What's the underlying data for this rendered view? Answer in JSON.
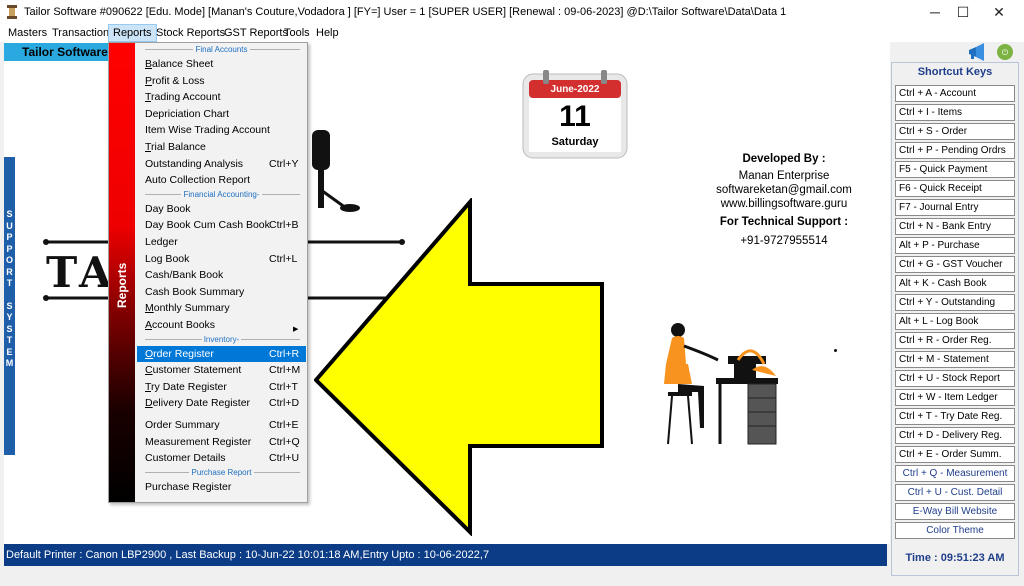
{
  "window": {
    "title": "Tailor Software #090622  [Edu. Mode] [Manan's Couture,Vodadora ] [FY=] User =  1 [SUPER USER]  [Renewal : 09-06-2023] @D:\\Tailor Software\\Data\\Data 1",
    "minimize": "─",
    "maximize": "☐",
    "close": "✕"
  },
  "menubar": [
    "Masters",
    "Transactions",
    "Reports",
    "Stock Reports",
    "GST Reports",
    "Tools",
    "Help"
  ],
  "app_label": "Tailor Software",
  "support_strip": [
    "S",
    "U",
    "P",
    "P",
    "O",
    "R",
    "T",
    "",
    "S",
    "Y",
    "S",
    "T",
    "E",
    "M"
  ],
  "logo": {
    "text": "TA        HOP"
  },
  "calendar": {
    "month": "June-2022",
    "day": "11",
    "weekday": "Saturday"
  },
  "developer": {
    "heading": "Developed By :",
    "name": "Manan Enterprise",
    "email": "softwareketan@gmail.com",
    "website": "www.billingsoftware.guru",
    "support_heading": "For Technical Support :",
    "phone": "+91-9727955514"
  },
  "dropdown": {
    "side_label": "Reports",
    "sections": [
      {
        "type": "sep",
        "label": "Final Accounts"
      },
      {
        "type": "item",
        "label": "Balance Sheet",
        "u": "B",
        "rest": "alance Sheet",
        "shortcut": ""
      },
      {
        "type": "item",
        "label": "Profit & Loss",
        "u": "P",
        "rest": "rofit & Loss",
        "shortcut": ""
      },
      {
        "type": "item",
        "label": "Trading Account",
        "u": "T",
        "rest": "rading Account",
        "shortcut": ""
      },
      {
        "type": "item",
        "label": "Depriciation Chart",
        "u": "",
        "rest": "Depriciation Chart",
        "shortcut": ""
      },
      {
        "type": "item",
        "label": "Item Wise Trading Account",
        "u": "",
        "rest": "Item Wise Trading Account",
        "shortcut": ""
      },
      {
        "type": "item",
        "label": "Trial Balance",
        "u": "T",
        "rest": "rial Balance",
        "shortcut": ""
      },
      {
        "type": "item",
        "label": "Outstanding Analysis",
        "u": "",
        "rest": "Outstanding Analysis",
        "shortcut": "Ctrl+Y"
      },
      {
        "type": "item",
        "label": "Auto Collection Report",
        "u": "",
        "rest": "Auto Collection Report",
        "shortcut": ""
      },
      {
        "type": "sep",
        "label": "Financial Accounting-"
      },
      {
        "type": "item",
        "label": "Day Book",
        "u": "",
        "rest": "Day Book",
        "shortcut": ""
      },
      {
        "type": "item",
        "label": "Day Book Cum Cash Book",
        "u": "",
        "rest": "Day Book Cum Cash Book",
        "shortcut": "Ctrl+B"
      },
      {
        "type": "item",
        "label": "Ledger",
        "u": "",
        "rest": "Ledger",
        "shortcut": ""
      },
      {
        "type": "item",
        "label": "Log Book",
        "u": "",
        "rest": "Log Book",
        "shortcut": "Ctrl+L"
      },
      {
        "type": "item",
        "label": "Cash/Bank Book",
        "u": "",
        "rest": "Cash/Bank Book",
        "shortcut": ""
      },
      {
        "type": "item",
        "label": "Cash Book Summary",
        "u": "",
        "rest": "Cash Book Summary",
        "shortcut": ""
      },
      {
        "type": "item",
        "label": "Monthly Summary",
        "u": "M",
        "rest": "onthly Summary",
        "shortcut": ""
      },
      {
        "type": "item",
        "label": "Account Books",
        "u": "A",
        "rest": "ccount Books",
        "shortcut": "",
        "submenu": true
      },
      {
        "type": "sep",
        "label": "Inventory-"
      },
      {
        "type": "item",
        "label": "Order Register",
        "u": "O",
        "rest": "rder Register",
        "shortcut": "Ctrl+R",
        "highlight": true
      },
      {
        "type": "item",
        "label": "Customer Statement",
        "u": "C",
        "rest": "ustomer Statement",
        "shortcut": "Ctrl+M"
      },
      {
        "type": "item",
        "label": "Try Date Register",
        "u": "T",
        "rest": "ry Date Register",
        "shortcut": "Ctrl+T"
      },
      {
        "type": "item",
        "label": "Delivery Date Register",
        "u": "D",
        "rest": "elivery Date Register",
        "shortcut": "Ctrl+D"
      },
      {
        "type": "gap"
      },
      {
        "type": "item",
        "label": "Order Summary",
        "u": "",
        "rest": "Order Summary",
        "shortcut": "Ctrl+E"
      },
      {
        "type": "item",
        "label": "Measurement Register",
        "u": "",
        "rest": "Measurement Register",
        "shortcut": "Ctrl+Q"
      },
      {
        "type": "item",
        "label": "Customer Details",
        "u": "",
        "rest": "Customer Details",
        "shortcut": "Ctrl+U"
      },
      {
        "type": "sep",
        "label": "Purchase Report"
      },
      {
        "type": "item",
        "label": "Purchase Register",
        "u": "",
        "rest": "Purchase Register",
        "shortcut": ""
      }
    ]
  },
  "shortcuts": {
    "title": "Shortcut Keys",
    "items": [
      "Ctrl + A - Account",
      "Ctrl + I - Items",
      "Ctrl + S - Order",
      "Ctrl + P - Pending Ordrs",
      "F5 - Quick Payment",
      "F6 - Quick Receipt",
      "F7 - Journal Entry",
      "Ctrl + N - Bank Entry",
      "Alt + P - Purchase",
      "Ctrl + G - GST Voucher",
      "Alt + K - Cash Book",
      "Ctrl + Y  -  Outstanding",
      "Alt + L  -  Log Book",
      "Ctrl + R - Order Reg.",
      "Ctrl + M - Statement",
      "Ctrl + U - Stock Report",
      "Ctrl + W - Item Ledger",
      "Ctrl + T - Try Date Reg.",
      "Ctrl + D - Delivery Reg.",
      "Ctrl + E - Order Summ.",
      "Ctrl + Q - Measurement",
      "Ctrl + U - Cust. Detail",
      "E-Way Bill Website",
      "Color Theme"
    ],
    "time": "Time : 09:51:23 AM"
  },
  "statusbar": "Default Printer : Canon LBP2900 , Last Backup : 10-Jun-22 10:01:18 AM,Entry Upto : 10-06-2022,7",
  "colors": {
    "accent": "#29a9e0",
    "status": "#0b3c85",
    "highlight": "#0078d7",
    "arrow": "#ffff00"
  },
  "icons": [
    "app-icon",
    "megaphone-icon",
    "exit-icon",
    "calendar-icon",
    "tailor-illustration-icon",
    "arrow-pointer-icon"
  ]
}
